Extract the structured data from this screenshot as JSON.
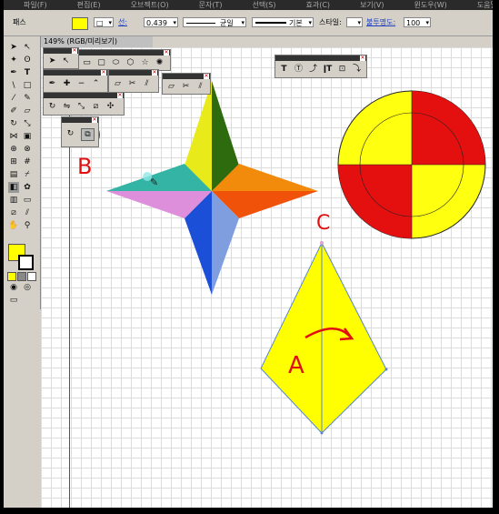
{
  "menubar": {
    "items": [
      "파일(F)",
      "편집(E)",
      "오브젝트(O)",
      "문자(T)",
      "선택(S)",
      "효과(C)",
      "보기(V)",
      "윈도우(W)",
      "도움말(H)"
    ]
  },
  "controlbar": {
    "label_path": "패스",
    "fill_color": "#ffff00",
    "stroke_label": "선:",
    "stroke_width": "0.439",
    "profile_uniform": "균일",
    "brush_basic": "기본",
    "style_label": "스타일:",
    "opacity_label": "불투명도:",
    "opacity_value": "100"
  },
  "document": {
    "tab_title": "149% (RGB/미리보기)"
  },
  "toolbox": {
    "fill_color": "#ffff00",
    "stroke_color": "#ffffff"
  },
  "annotations": {
    "a": "A",
    "b": "B",
    "c": "C",
    "color": "#e01010"
  },
  "colors": {
    "star_top_left": "#e8ea1a",
    "star_top_right": "#2e6b0e",
    "star_right_top": "#f28a0c",
    "star_right_bottom": "#f0520a",
    "star_bottom_right": "#7f9ee0",
    "star_bottom_left": "#1b4fd8",
    "star_left_bottom": "#de8fdc",
    "star_left_top": "#34b4a4",
    "target_red": "#e41010",
    "target_yellow": "#ffff10",
    "kite_fill": "#ffff00",
    "kite_stroke": "#5a86d0"
  }
}
